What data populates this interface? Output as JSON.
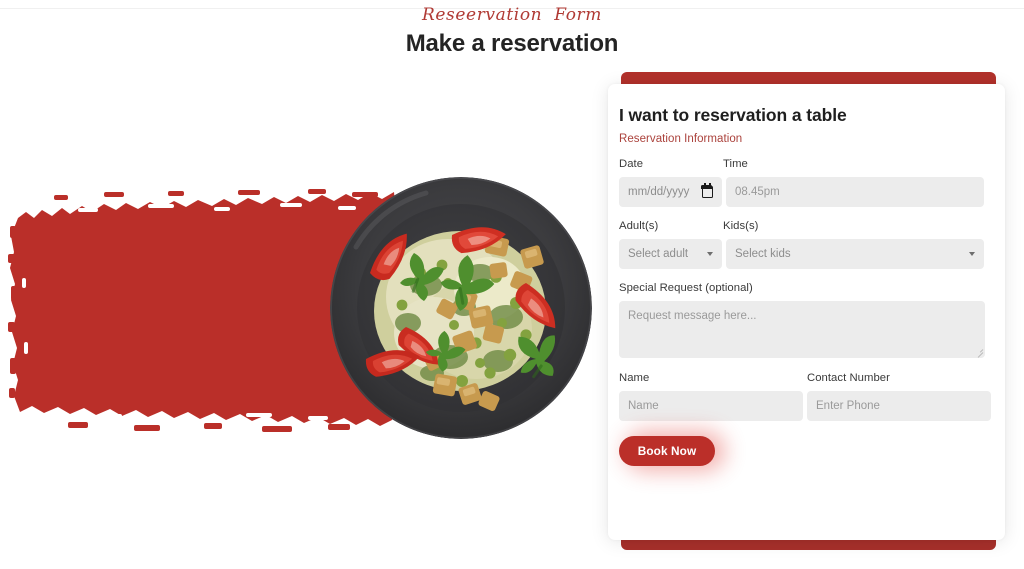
{
  "page": {
    "script_title": "Reseervation  Form",
    "main_title": "Make a reservation"
  },
  "hero": {
    "brush_name": "red-paint-brush-stroke",
    "brush_color": "#ba2f29",
    "dish_name": "salad-plate-photo",
    "plate_color": "#3a3a3c"
  },
  "card": {
    "title": "I want to reservation a table",
    "subtitle": "Reservation Information",
    "accent_color": "#b2312b",
    "subtitle_color": "#ab423c",
    "labels": {
      "date": "Date",
      "time": "Time",
      "adults": "Adult(s)",
      "kids": "Kids(s)",
      "special_request": "Special Request (optional)",
      "name": "Name",
      "contact_number": "Contact Number"
    },
    "fields": {
      "date_placeholder": "mm/dd/yyyy",
      "time_placeholder": "08.45pm",
      "adults_selected": "Select adult",
      "kids_selected": "Select kids",
      "request_placeholder": "Request message here...",
      "name_placeholder": "Name",
      "phone_placeholder": "Enter Phone"
    },
    "submit_label": "Book Now"
  },
  "icons": {
    "calendar": "calendar-icon",
    "chevron_adults": "chevron-down-icon",
    "chevron_kids": "chevron-down-icon",
    "resize": "resize-handle-icon"
  }
}
